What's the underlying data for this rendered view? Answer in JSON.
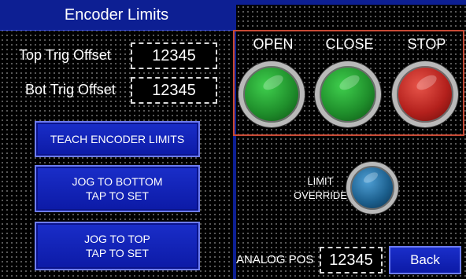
{
  "header": {
    "title": "Encoder Limits"
  },
  "offsets": {
    "top_label": "Top Trig Offset",
    "top_value": "12345",
    "bot_label": "Bot Trig Offset",
    "bot_value": "12345"
  },
  "buttons": {
    "teach": "TEACH ENCODER LIMITS",
    "jog_bottom": "JOG TO BOTTOM\nTAP TO SET",
    "jog_top": "JOG TO TOP\nTAP TO SET",
    "back": "Back"
  },
  "lights": [
    {
      "label": "OPEN",
      "color": "#1f8e2b"
    },
    {
      "label": "CLOSE",
      "color": "#1f8e2b"
    },
    {
      "label": "STOP",
      "color": "#b3201c"
    }
  ],
  "limit_override": {
    "label": "LIMIT\nOVERRIDE",
    "color": "#1b5e8c"
  },
  "analog": {
    "label": "ANALOG POS",
    "value": "12345"
  }
}
